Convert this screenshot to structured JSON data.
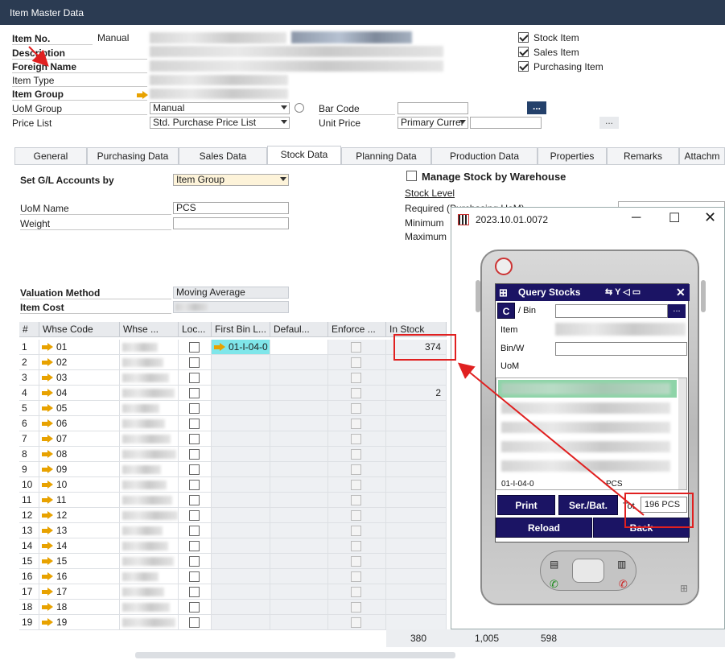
{
  "window": {
    "title": "Item Master Data"
  },
  "header": {
    "item_no_label": "Item No.",
    "item_no_series": "Manual",
    "description_label": "Description",
    "foreign_name_label": "Foreign Name",
    "item_type_label": "Item Type",
    "item_group_label": "Item Group",
    "uom_group_label": "UoM Group",
    "uom_group_value": "Manual",
    "price_list_label": "Price List",
    "price_list_value": "Std. Purchase Price List",
    "bar_code_label": "Bar Code",
    "unit_price_label": "Unit Price",
    "unit_price_currency": "Primary Currer",
    "ellipsis": "...",
    "checkboxes": [
      {
        "label": "Stock Item",
        "checked": true
      },
      {
        "label": "Sales Item",
        "checked": true
      },
      {
        "label": "Purchasing Item",
        "checked": true
      }
    ]
  },
  "tabs": [
    "General",
    "Purchasing Data",
    "Sales Data",
    "Stock Data",
    "Planning Data",
    "Production Data",
    "Properties",
    "Remarks",
    "Attachm"
  ],
  "active_tab": "Stock Data",
  "stock": {
    "set_gl_label": "Set G/L Accounts by",
    "set_gl_value": "Item Group",
    "manage_by_wh_label": "Manage Stock by Warehouse",
    "stock_level_label": "Stock Level",
    "required_label": "Required (Purchasing UoM)",
    "minimum_label": "Minimum",
    "maximum_label": "Maximum",
    "uom_name_label": "UoM Name",
    "uom_name_value": "PCS",
    "weight_label": "Weight",
    "valuation_label": "Valuation Method",
    "valuation_value": "Moving Average",
    "item_cost_label": "Item Cost"
  },
  "grid": {
    "headers": [
      "#",
      "Whse Code",
      "Whse ...",
      "Loc...",
      "First Bin L...",
      "Defaul...",
      "Enforce ...",
      "In Stock"
    ],
    "rows": [
      {
        "num": "1",
        "code": "01",
        "bin": "01-I-04-0",
        "stock": "374"
      },
      {
        "num": "2",
        "code": "02",
        "bin": "",
        "stock": ""
      },
      {
        "num": "3",
        "code": "03",
        "bin": "",
        "stock": ""
      },
      {
        "num": "4",
        "code": "04",
        "bin": "",
        "stock": "2"
      },
      {
        "num": "5",
        "code": "05",
        "bin": "",
        "stock": ""
      },
      {
        "num": "6",
        "code": "06",
        "bin": "",
        "stock": ""
      },
      {
        "num": "7",
        "code": "07",
        "bin": "",
        "stock": ""
      },
      {
        "num": "8",
        "code": "08",
        "bin": "",
        "stock": ""
      },
      {
        "num": "9",
        "code": "09",
        "bin": "",
        "stock": ""
      },
      {
        "num": "10",
        "code": "10",
        "bin": "",
        "stock": ""
      },
      {
        "num": "11",
        "code": "11",
        "bin": "",
        "stock": ""
      },
      {
        "num": "12",
        "code": "12",
        "bin": "",
        "stock": ""
      },
      {
        "num": "13",
        "code": "13",
        "bin": "",
        "stock": ""
      },
      {
        "num": "14",
        "code": "14",
        "bin": "",
        "stock": ""
      },
      {
        "num": "15",
        "code": "15",
        "bin": "",
        "stock": ""
      },
      {
        "num": "16",
        "code": "16",
        "bin": "",
        "stock": ""
      },
      {
        "num": "17",
        "code": "17",
        "bin": "",
        "stock": ""
      },
      {
        "num": "18",
        "code": "18",
        "bin": "",
        "stock": ""
      },
      {
        "num": "19",
        "code": "19",
        "bin": "",
        "stock": ""
      }
    ],
    "totals": [
      "380",
      "1,005",
      "598"
    ]
  },
  "emulator": {
    "title": "2023.10.01.0072",
    "app_title": "Query Stocks",
    "c_button": "C",
    "bin_label": "/ Bin",
    "item_label": "Item",
    "binloc_label": "Bin/W",
    "uom_label": "UoM",
    "list_last_row": "01-I-04-0",
    "list_last_uom": "PCS",
    "print_button": "Print",
    "serbat_button": "Ser./Bat.",
    "tot_label": "Tot.",
    "tot_value": "196 PCS",
    "reload_button": "Reload",
    "back_button": "Back",
    "browse": "..."
  },
  "colors": {
    "accent": "#e8a200",
    "highlight": "#e02020",
    "ppc_blue": "#1b1464",
    "bin_cell": "#7fe6ea"
  }
}
